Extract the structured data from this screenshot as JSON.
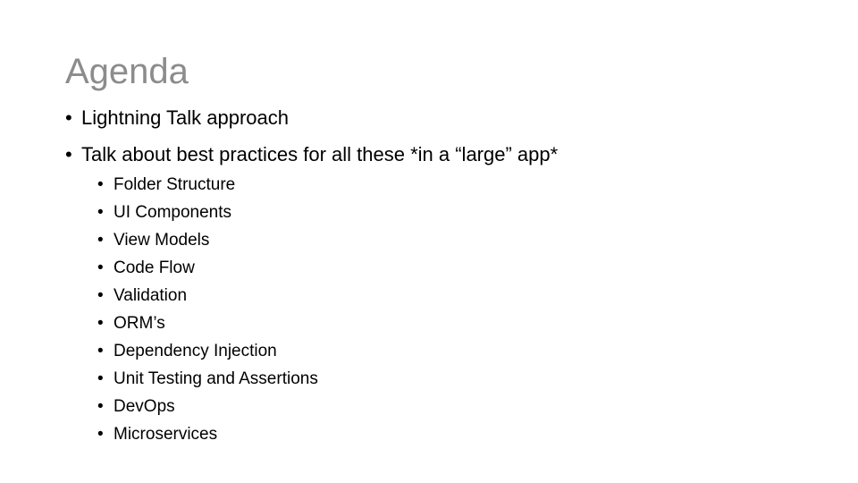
{
  "slide": {
    "title": "Agenda",
    "bullet_glyph": "•",
    "points": [
      {
        "text": "Lightning Talk approach"
      },
      {
        "text": "Talk about best practices for all these *in a “large” app*"
      }
    ],
    "sub_points": [
      {
        "text": "Folder Structure"
      },
      {
        "text": "UI Components"
      },
      {
        "text": "View Models"
      },
      {
        "text": "Code Flow"
      },
      {
        "text": "Validation"
      },
      {
        "text": "ORM’s"
      },
      {
        "text": "Dependency Injection"
      },
      {
        "text": "Unit Testing and Assertions"
      },
      {
        "text": "DevOps"
      },
      {
        "text": "Microservices"
      }
    ]
  }
}
